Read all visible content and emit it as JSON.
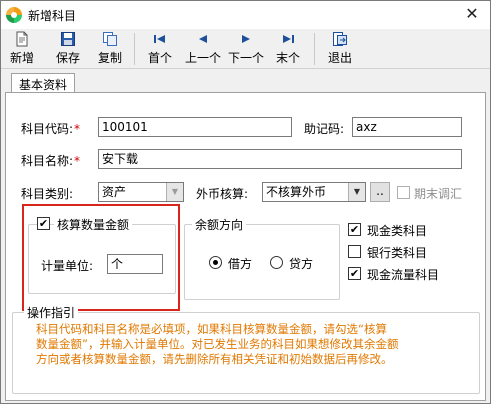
{
  "window": {
    "title": "新增科目",
    "close_label": "✕"
  },
  "toolbar": {
    "add_label": "新增",
    "save_label": "保存",
    "copy_label": "复制",
    "first_label": "首个",
    "prev_label": "上一个",
    "next_label": "下一个",
    "last_label": "末个",
    "exit_label": "退出"
  },
  "tabs": {
    "basic_label": "基本资料"
  },
  "form": {
    "code_label": "科目代码:",
    "code_value": "100101",
    "mnemonic_label": "助记码:",
    "mnemonic_value": "axz",
    "name_label": "科目名称:",
    "name_value": "安下载",
    "category_label": "科目类别:",
    "category_value": "资产",
    "currency_label": "外币核算:",
    "currency_value": "不核算外币",
    "currency_button_label": "..",
    "period_end_label": "期末调汇",
    "required_mark": "*"
  },
  "quantity": {
    "checkbox_label": "核算数量金额",
    "checked": true,
    "unit_label": "计量单位:",
    "unit_value": "个"
  },
  "balance": {
    "group_label": "余额方向",
    "debit_label": "借方",
    "credit_label": "贷方",
    "selected": "借方"
  },
  "flags": {
    "cash_label": "现金类科目",
    "cash_checked": true,
    "bank_label": "银行类科目",
    "bank_checked": false,
    "cashflow_label": "现金流量科目",
    "cashflow_checked": true
  },
  "guide": {
    "title": "操作指引",
    "line1": "科目代码和科目名称是必填项，如果科目核算数量金额，请勾选“核算",
    "line2": "数量金额”，并输入计量单位。对已发生业务的科目如果想修改其余金额",
    "line3": "方向或者核算数量金额，请先删除所有相关凭证和初始数据后再修改。"
  },
  "colors": {
    "highlight": "#d9261c",
    "hint_text": "#e07800",
    "required": "#d00000"
  },
  "icons": [
    "app-logo-icon",
    "close-icon",
    "new-doc-icon",
    "save-disk-icon",
    "copy-icon",
    "first-record-icon",
    "prev-record-icon",
    "next-record-icon",
    "last-record-icon",
    "exit-icon",
    "chevron-down-icon",
    "checkmark-icon"
  ]
}
